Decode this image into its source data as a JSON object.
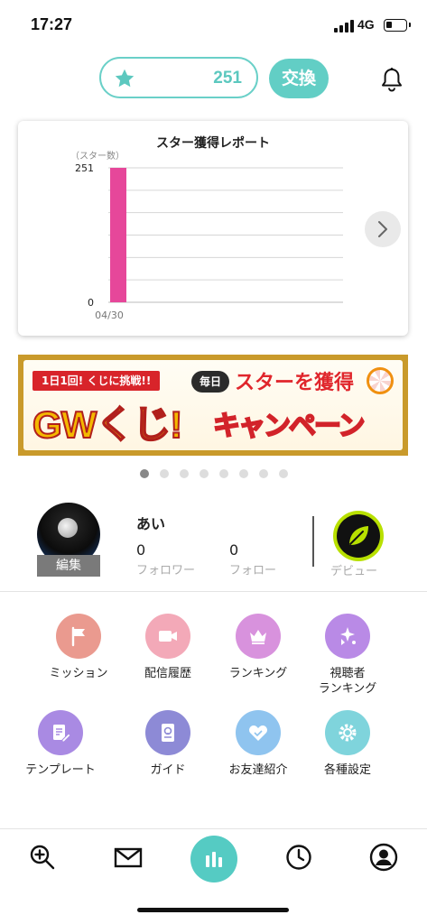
{
  "status_bar": {
    "time": "17:27",
    "network": "4G"
  },
  "header": {
    "star_count": "251",
    "exchange_label": "交換"
  },
  "report": {
    "title": "スター獲得レポート",
    "unit_label": "（スター数）"
  },
  "chart_data": {
    "type": "bar",
    "title": "スター獲得レポート",
    "ylabel": "（スター数）",
    "categories": [
      "04/30"
    ],
    "values": [
      251
    ],
    "ylim": [
      0,
      251
    ],
    "y_ticks": [
      "251",
      "0"
    ],
    "grid": true,
    "color": "#e6479a"
  },
  "banner": {
    "tag": "1日1回! くじに挑戦!!",
    "daily": "毎日",
    "headline": "スターを獲得",
    "gw": "GWくじ!",
    "campaign": "キャンペーン"
  },
  "carousel": {
    "count": 8,
    "active_index": 0
  },
  "profile": {
    "edit_label": "編集",
    "name": "あい",
    "followers": {
      "count": "0",
      "label": "フォロワー"
    },
    "following": {
      "count": "0",
      "label": "フォロー"
    },
    "debut_label": "デビュー"
  },
  "menu": [
    {
      "label": "ミッション",
      "icon": "flag-icon",
      "color": "#ea9a8f"
    },
    {
      "label": "配信履歴",
      "icon": "video-camera-icon",
      "color": "#f3a9b8"
    },
    {
      "label": "ランキング",
      "icon": "crown-icon",
      "color": "#d892dd"
    },
    {
      "label": "視聴者\nランキング",
      "icon": "sparkle-ranking-icon",
      "color": "#b98ae6"
    },
    {
      "label": "テンプレート",
      "icon": "template-icon",
      "color": "#a98ae3"
    },
    {
      "label": "ガイド",
      "icon": "guide-book-icon",
      "color": "#8d8ad6"
    },
    {
      "label": "お友達紹介",
      "icon": "handshake-heart-icon",
      "color": "#8fc4ef"
    },
    {
      "label": "各種設定",
      "icon": "settings-gear-icon",
      "color": "#7fd4dc"
    }
  ],
  "bottom_nav": [
    {
      "name": "search",
      "icon": "zoom-plus-icon"
    },
    {
      "name": "mail",
      "icon": "mail-icon"
    },
    {
      "name": "stats",
      "icon": "bar-chart-icon",
      "color": "#55cbc3"
    },
    {
      "name": "history",
      "icon": "clock-icon"
    },
    {
      "name": "profile",
      "icon": "user-avatar-icon"
    }
  ]
}
